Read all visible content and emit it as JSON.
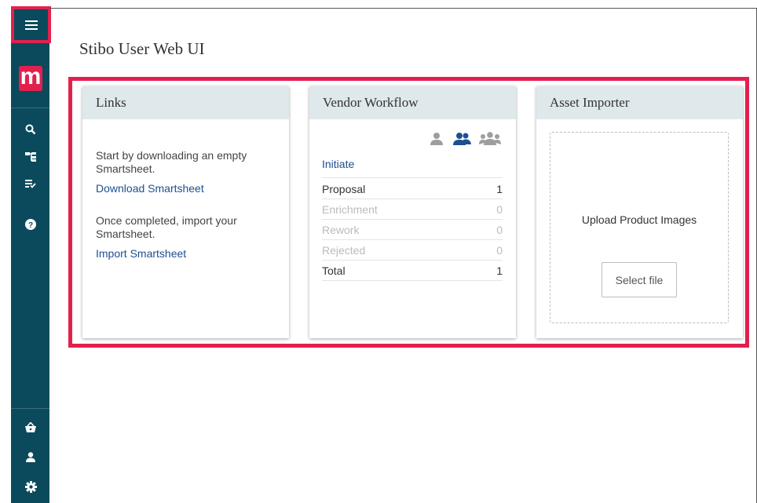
{
  "page": {
    "title": "Stibo User Web UI"
  },
  "sidebar": {
    "logo_letter": "m",
    "top_icons": [
      "search-icon",
      "hierarchy-icon",
      "task-list-icon",
      "help-icon"
    ],
    "bottom_icons": [
      "basket-icon",
      "user-icon",
      "settings-icon"
    ],
    "accent": "#e2204e",
    "background": "#0b4a5c"
  },
  "cards": {
    "links": {
      "title": "Links",
      "text1": "Start by downloading an empty Smartsheet.",
      "link1": "Download Smartsheet",
      "text2": "Once completed, import your Smartsheet.",
      "link2": "Import Smartsheet"
    },
    "workflow": {
      "title": "Vendor Workflow",
      "initiate": "Initiate",
      "rows": [
        {
          "label": "Proposal",
          "count": "1"
        },
        {
          "label": "Enrichment",
          "count": "0"
        },
        {
          "label": "Rework",
          "count": "0"
        },
        {
          "label": "Rejected",
          "count": "0"
        },
        {
          "label": "Total",
          "count": "1"
        }
      ]
    },
    "asset": {
      "title": "Asset Importer",
      "upload_label": "Upload Product Images",
      "select_label": "Select file"
    }
  }
}
